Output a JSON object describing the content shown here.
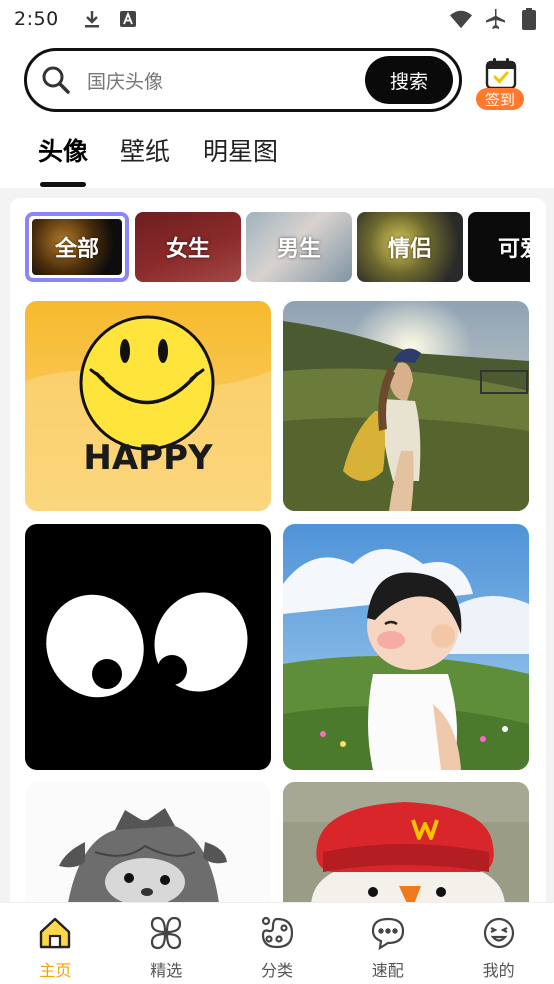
{
  "status_bar": {
    "time": "2:50",
    "left_icons": [
      "download-icon",
      "text-a-icon"
    ],
    "right_icons": [
      "wifi-icon",
      "airplane-icon",
      "battery-icon"
    ]
  },
  "search": {
    "placeholder": "国庆头像",
    "button_label": "搜索"
  },
  "checkin": {
    "label": "签到",
    "icon": "calendar-check-icon"
  },
  "tabs": [
    {
      "label": "头像",
      "active": true
    },
    {
      "label": "壁纸",
      "active": false
    },
    {
      "label": "明星图",
      "active": false
    }
  ],
  "categories": [
    {
      "label": "全部",
      "active": true
    },
    {
      "label": "女生",
      "active": false
    },
    {
      "label": "男生",
      "active": false
    },
    {
      "label": "情侣",
      "active": false
    },
    {
      "label": "可爱",
      "active": false
    }
  ],
  "grid": {
    "happy_text": "HAPPY",
    "tiles": [
      {
        "subject": "yellow-smiley-face"
      },
      {
        "subject": "girl-at-sunset-field"
      },
      {
        "subject": "cartoon-eyes"
      },
      {
        "subject": "cartoon-boy-in-field"
      },
      {
        "subject": "sketch-creature"
      },
      {
        "subject": "plush-toy-red-hat"
      }
    ]
  },
  "bottom_nav": [
    {
      "label": "主页",
      "icon": "home-icon",
      "active": true
    },
    {
      "label": "精选",
      "icon": "clover-icon",
      "active": false
    },
    {
      "label": "分类",
      "icon": "palette-icon",
      "active": false
    },
    {
      "label": "速配",
      "icon": "chat-bubble-icon",
      "active": false
    },
    {
      "label": "我的",
      "icon": "face-icon",
      "active": false
    }
  ],
  "colors": {
    "accent": "#f5a300",
    "checkin_badge": "#ff7a2e",
    "active_chip_border": "#8a86f5"
  }
}
